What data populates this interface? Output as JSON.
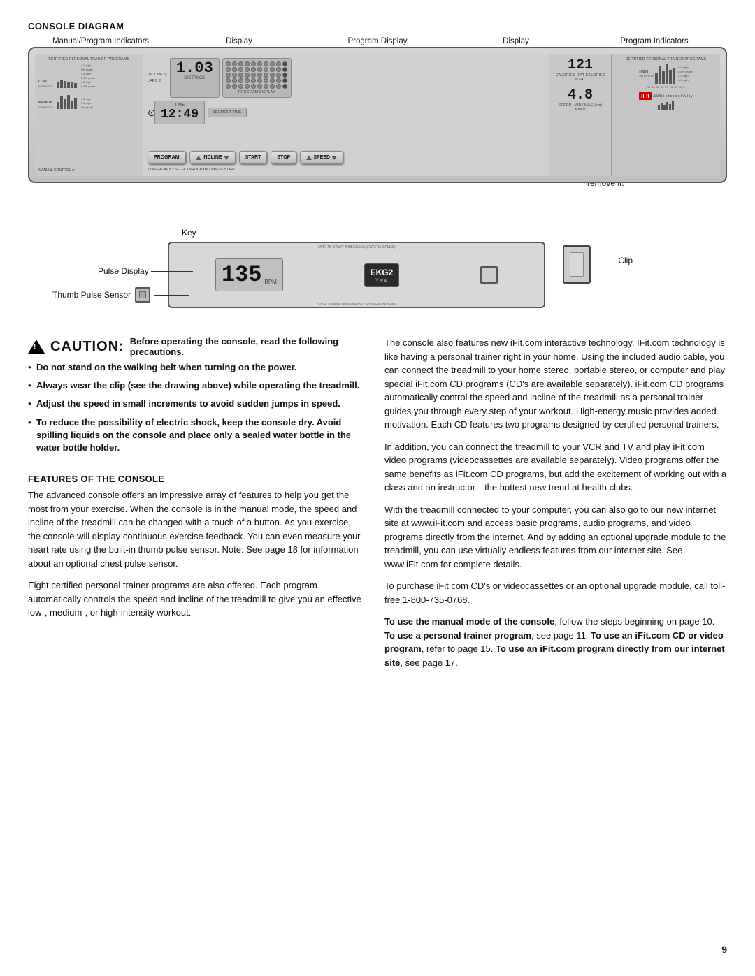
{
  "diagram": {
    "title": "CONSOLE DIAGRAM",
    "labels_top": [
      "Manual/Program Indicators",
      "Display",
      "Program Display",
      "Display",
      "Program Indicators"
    ],
    "display_values": {
      "distance": "1.03",
      "time": "12:49",
      "segment_time_label": "SEGMENT TIME",
      "calories": "121",
      "speed": "4.8",
      "pulse": "135",
      "bpm": "BPM"
    },
    "buttons": [
      "PROGRAM",
      "INCLINE",
      "START",
      "STOP",
      "SPEED"
    ],
    "note": "Note: If there is a thin sheet of clear plastic on the face of the console, remove it.",
    "key_label": "Key",
    "clip_label": "Clip",
    "pulse_display_label": "Pulse Display",
    "thumb_sensor_label": "Thumb Pulse Sensor"
  },
  "caution": {
    "triangle_symbol": "⚠",
    "title": "CAUTION:",
    "subtitle": "Before operating the console, read the following precautions.",
    "bullets": [
      "Do not stand on the walking belt when turning on the power.",
      "Always wear the clip (see the drawing above) while operating the treadmill.",
      "Adjust the speed in small increments to avoid sudden jumps in speed.",
      "To reduce the possibility of electric shock, keep the console dry. Avoid spilling liquids on the console and place only a sealed water bottle in the water bottle holder."
    ],
    "bullets_bold": [
      false,
      false,
      false,
      true
    ]
  },
  "features": {
    "title": "FEATURES OF THE CONSOLE",
    "paragraphs": [
      "The advanced console offers an impressive array of features to help you get the most from your exercise. When the console is in the manual mode, the speed and incline of the treadmill can be changed with a touch of a button. As you exercise, the console will display continuous exercise feedback. You can even measure your heart rate using the built-in thumb pulse sensor. Note: See page 18 for information about an optional chest pulse sensor.",
      "Eight certified personal trainer programs are also offered. Each program automatically controls the speed and incline of the treadmill to give you an effective low-, medium-, or high-intensity workout."
    ]
  },
  "right_column": {
    "paragraphs": [
      "The console also features new iFit.com interactive technology. IFit.com technology is like having a personal trainer right in your home. Using the included audio cable, you can connect the treadmill to your home stereo, portable stereo, or computer and play special iFit.com CD programs (CD's are available separately). iFit.com CD programs automatically control the speed and incline of the treadmill as a personal trainer guides you through every step of your workout. High-energy music provides added motivation. Each CD features two programs designed by certified personal trainers.",
      "In addition, you can connect the treadmill to your VCR and TV and play iFit.com video programs (videocassettes are available separately). Video programs offer the same benefits as iFit.com CD programs, but add the excitement of working out with a class and an instructor—the hottest new trend at health clubs.",
      "With the treadmill connected to your computer, you can also go to our new internet site at www.iFit.com and access basic programs, audio programs, and video programs directly from the internet. And by adding an optional upgrade module to the treadmill, you can use virtually endless features from our internet site. See www.iFit.com for complete details.",
      "To purchase iFit.com CD's or videocassettes or an optional upgrade module, call toll-free 1-800-735-0768.",
      "To use the manual mode of the console, follow the steps beginning on page 10. To use a personal trainer program, see page 11. To use an iFit.com CD or video program, refer to page 15. To use an iFit.com program directly from our internet site, see page 17."
    ],
    "last_para_bold_phrases": [
      "To use the manual mode of the console",
      "To use a personal trainer program",
      "To use an iFit.com CD or video program",
      "To use an iFit.com program directly from our internet site"
    ]
  },
  "page_number": "9"
}
